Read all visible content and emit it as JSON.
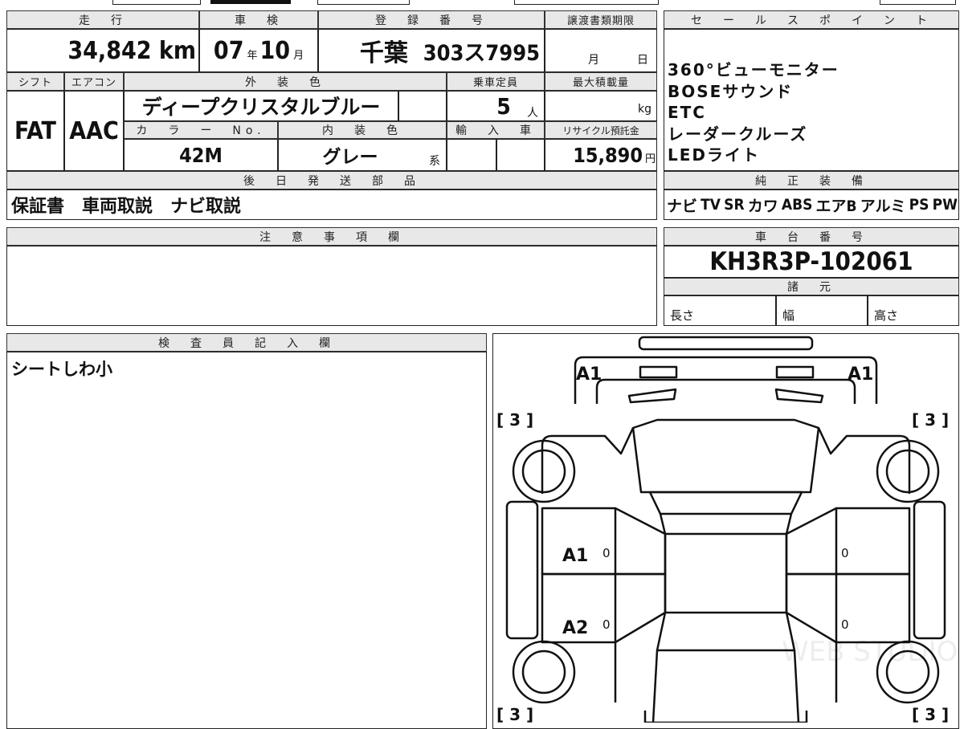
{
  "top_left": {
    "headers": {
      "mileage": "走　行",
      "inspection": "車　検",
      "registration": "登　録　番　号",
      "transfer_deadline": "譲渡書類期限"
    },
    "mileage_value": "34,842",
    "mileage_unit": "km",
    "inspection_year": "07",
    "inspection_year_unit": "年",
    "inspection_month": "10",
    "inspection_month_unit": "月",
    "registration_place": "千葉",
    "registration_number": "303ス7995",
    "transfer_month": "月",
    "transfer_day": "日",
    "row2_headers": {
      "shift": "シフト",
      "aircon": "エアコン",
      "exterior_color": "外　装　色",
      "capacity": "乗車定員",
      "max_load": "最大積載量"
    },
    "shift": "FAT",
    "aircon": "AAC",
    "exterior_color": "ディープクリスタルブルー",
    "capacity": "5",
    "capacity_unit": "人",
    "load_unit": "kg",
    "row3_headers": {
      "color_no": "カ　ラ　ー　No.",
      "interior_color": "内　装　色",
      "import": "輸　入　車",
      "recycle": "リサイクル預託金"
    },
    "color_no": "42M",
    "interior_color": "グレー",
    "interior_suffix": "系",
    "recycle_fee": "15,890",
    "recycle_unit": "円",
    "later_parts_header": "後　日　発　送　部　品",
    "later_parts": "保証書　車両取説　ナビ取説"
  },
  "sales_points": {
    "header": "セ　ー　ル　ス　ポ　イ　ン　ト",
    "items": [
      "360°ビューモニター",
      "BOSEサウンド",
      "ETC",
      "レーダークルーズ",
      "LEDライト"
    ]
  },
  "genuine_equipment": {
    "header": "純　正　装　備",
    "items": [
      "ナビ",
      "TV",
      "SR",
      "カワ",
      "ABS",
      "エアB",
      "アルミ",
      "PS",
      "PW"
    ]
  },
  "notes": {
    "header": "注　意　事　項　欄",
    "content": ""
  },
  "chassis": {
    "header": "車　台　番　号",
    "value": "KH3R3P-102061"
  },
  "specs": {
    "header": "諸　元",
    "length": "長さ",
    "width": "幅",
    "height": "高さ"
  },
  "inspector": {
    "header": "検　査　員　記　入　欄",
    "content": "シートしわ小"
  },
  "diagram": {
    "marks": {
      "front_left": "A1",
      "front_right": "A1",
      "left_front_door": "A1",
      "left_rear_door": "A2"
    },
    "brackets": {
      "top_left": "[ 3 ]",
      "top_right": "[ 3 ]",
      "bottom_left": "[ 3 ]",
      "bottom_right": "[ 3 ]"
    },
    "zero": "0",
    "watermark": "WEB STUDIO PRO"
  }
}
